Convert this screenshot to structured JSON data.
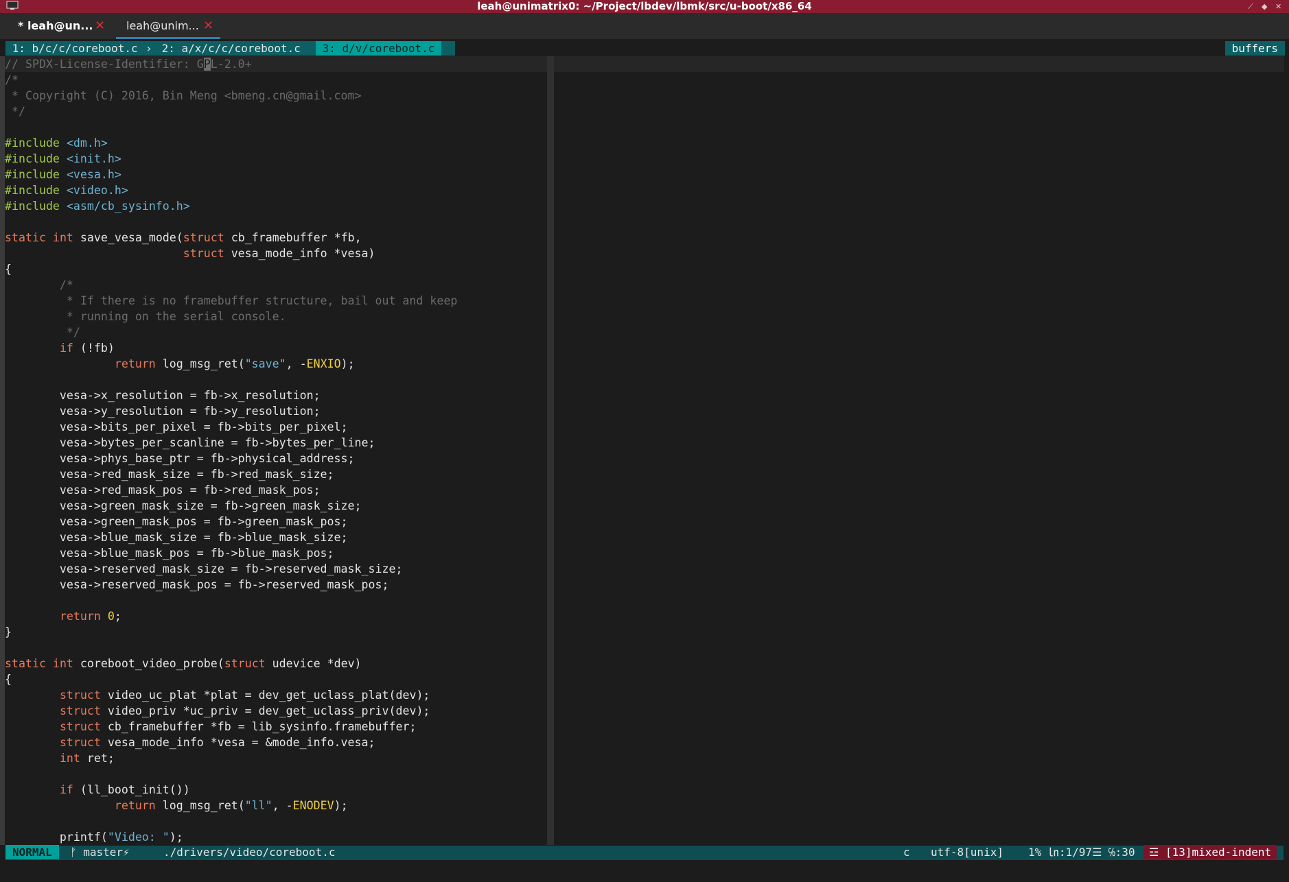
{
  "window": {
    "title": "leah@unimatrix0: ~/Project/lbdev/lbmk/src/u-boot/x86_64",
    "icon": "terminal-icon",
    "controls": [
      "⟋",
      "◆",
      "✕"
    ]
  },
  "tabs": [
    {
      "label": "* leah@un...",
      "close": "✕"
    },
    {
      "label": "leah@unim...",
      "close": "✕"
    }
  ],
  "bufferline": {
    "buffers": [
      {
        "label": " 1: b/c/c/coreboot.c "
      },
      {
        "label": " 2: a/x/c/c/coreboot.c "
      },
      {
        "label": " 3: d/v/coreboot.c "
      }
    ],
    "right_label": "buffers"
  },
  "code": {
    "lines": [
      "// SPDX-License-Identifier: GPL-2.0+",
      "/*",
      " * Copyright (C) 2016, Bin Meng <bmeng.cn@gmail.com>",
      " */",
      "",
      "#include <dm.h>",
      "#include <init.h>",
      "#include <vesa.h>",
      "#include <video.h>",
      "#include <asm/cb_sysinfo.h>",
      "",
      "static int save_vesa_mode(struct cb_framebuffer *fb,",
      "                          struct vesa_mode_info *vesa)",
      "{",
      "        /*",
      "         * If there is no framebuffer structure, bail out and keep",
      "         * running on the serial console.",
      "         */",
      "        if (!fb)",
      "                return log_msg_ret(\"save\", -ENXIO);",
      "",
      "        vesa->x_resolution = fb->x_resolution;",
      "        vesa->y_resolution = fb->y_resolution;",
      "        vesa->bits_per_pixel = fb->bits_per_pixel;",
      "        vesa->bytes_per_scanline = fb->bytes_per_line;",
      "        vesa->phys_base_ptr = fb->physical_address;",
      "        vesa->red_mask_size = fb->red_mask_size;",
      "        vesa->red_mask_pos = fb->red_mask_pos;",
      "        vesa->green_mask_size = fb->green_mask_size;",
      "        vesa->green_mask_pos = fb->green_mask_pos;",
      "        vesa->blue_mask_size = fb->blue_mask_size;",
      "        vesa->blue_mask_pos = fb->blue_mask_pos;",
      "        vesa->reserved_mask_size = fb->reserved_mask_size;",
      "        vesa->reserved_mask_pos = fb->reserved_mask_pos;",
      "",
      "        return 0;",
      "}",
      "",
      "static int coreboot_video_probe(struct udevice *dev)",
      "{",
      "        struct video_uc_plat *plat = dev_get_uclass_plat(dev);",
      "        struct video_priv *uc_priv = dev_get_uclass_priv(dev);",
      "        struct cb_framebuffer *fb = lib_sysinfo.framebuffer;",
      "        struct vesa_mode_info *vesa = &mode_info.vesa;",
      "        int ret;",
      "",
      "        if (ll_boot_init())",
      "                return log_msg_ret(\"ll\", -ENODEV);",
      "",
      "        printf(\"Video: \");"
    ]
  },
  "statusline": {
    "mode": "NORMAL",
    "branch": "ᚠ master⚡",
    "file": "./drivers/video/coreboot.c",
    "filetype": "c",
    "encoding": "utf-8[unix]",
    "position": "1% ㏑:1/97☰ ℅:30",
    "warning": "☲ [13]mixed-indent"
  }
}
